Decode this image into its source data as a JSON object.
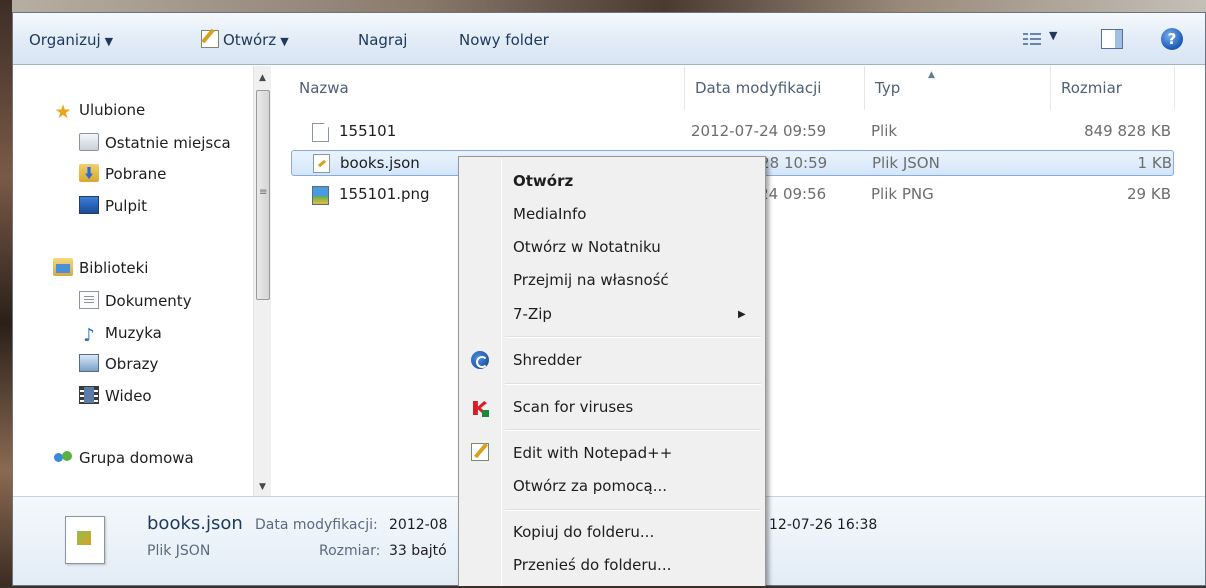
{
  "toolbar": {
    "organize": "Organizuj",
    "open": "Otwórz",
    "burn": "Nagraj",
    "new_folder": "Nowy folder",
    "help": "?"
  },
  "nav": {
    "favorites": "Ulubione",
    "recent": "Ostatnie miejsca",
    "downloads": "Pobrane",
    "desktop": "Pulpit",
    "libraries": "Biblioteki",
    "documents": "Dokumenty",
    "music": "Muzyka",
    "pictures": "Obrazy",
    "videos": "Wideo",
    "homegroup": "Grupa domowa"
  },
  "columns": {
    "name": "Nazwa",
    "modified": "Data modyfikacji",
    "type": "Typ",
    "size": "Rozmiar"
  },
  "files": [
    {
      "name": "155101",
      "modified": "2012-07-24 09:59",
      "type": "Plik",
      "size": "849 828 KB"
    },
    {
      "name": "books.json",
      "modified": "2012-08-28 10:59",
      "type": "Plik JSON",
      "size": "1 KB"
    },
    {
      "name": "155101.png",
      "modified": "2012-07-24 09:56",
      "type": "Plik PNG",
      "size": "29 KB"
    }
  ],
  "details": {
    "filename": "books.json",
    "modified_label": "Data modyfikacji:",
    "modified_value": "2012-08",
    "created_value": "12-07-26 16:38",
    "type": "Plik JSON",
    "size_label": "Rozmiar:",
    "size_value": "33 bajtó"
  },
  "context_menu": {
    "open": "Otwórz",
    "mediainfo": "MediaInfo",
    "open_notepad": "Otwórz w Notatniku",
    "take_ownership": "Przejmij na własność",
    "zip": "7-Zip",
    "shredder": "Shredder",
    "scan": "Scan for viruses",
    "npp": "Edit with Notepad++",
    "open_with": "Otwórz za pomocą...",
    "copy_to": "Kopiuj do folderu...",
    "move_to": "Przenieś do folderu..."
  },
  "colors": {
    "selection_border": "#84acdd",
    "header_text": "#4c607a",
    "toolbar_text": "#1e395b"
  }
}
